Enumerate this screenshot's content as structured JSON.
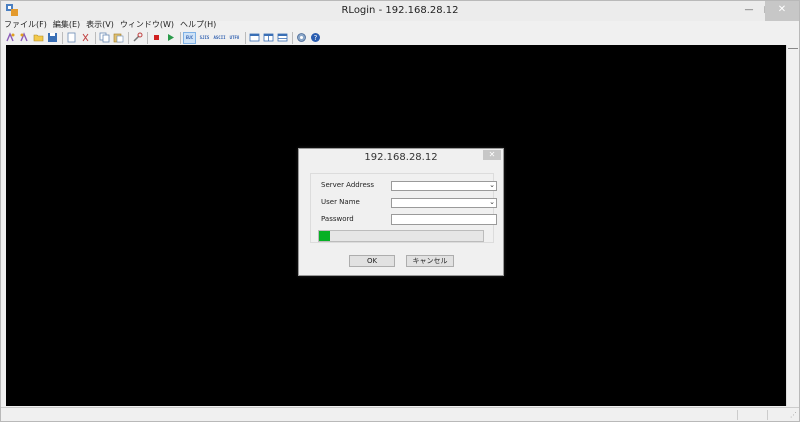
{
  "window": {
    "title": "RLogin - 192.168.28.12",
    "icon": "rlogin-app-icon",
    "minimize_glyph": "—",
    "maximize_glyph": "□",
    "close_glyph": "✕"
  },
  "menu": {
    "items": [
      "ファイル(F)",
      "編集(E)",
      "表示(V)",
      "ウィンドウ(W)",
      "ヘルプ(H)"
    ]
  },
  "toolbar": {
    "text_buttons": [
      "EUC",
      "SJIS",
      "ASCII",
      "UTF8"
    ],
    "active": "EUC"
  },
  "dialog": {
    "title": "192.168.28.12",
    "close_glyph": "✕",
    "server_address_label": "Server Address",
    "server_address_value": "",
    "user_name_label": "User Name",
    "user_name_value": "",
    "password_label": "Password",
    "password_value": "",
    "progress": 0.07,
    "progress_color": "#06b025",
    "ok_label": "OK",
    "cancel_label": "キャンセル"
  },
  "colors": {
    "terminal_bg": "#000000",
    "accent": "#06b025"
  }
}
